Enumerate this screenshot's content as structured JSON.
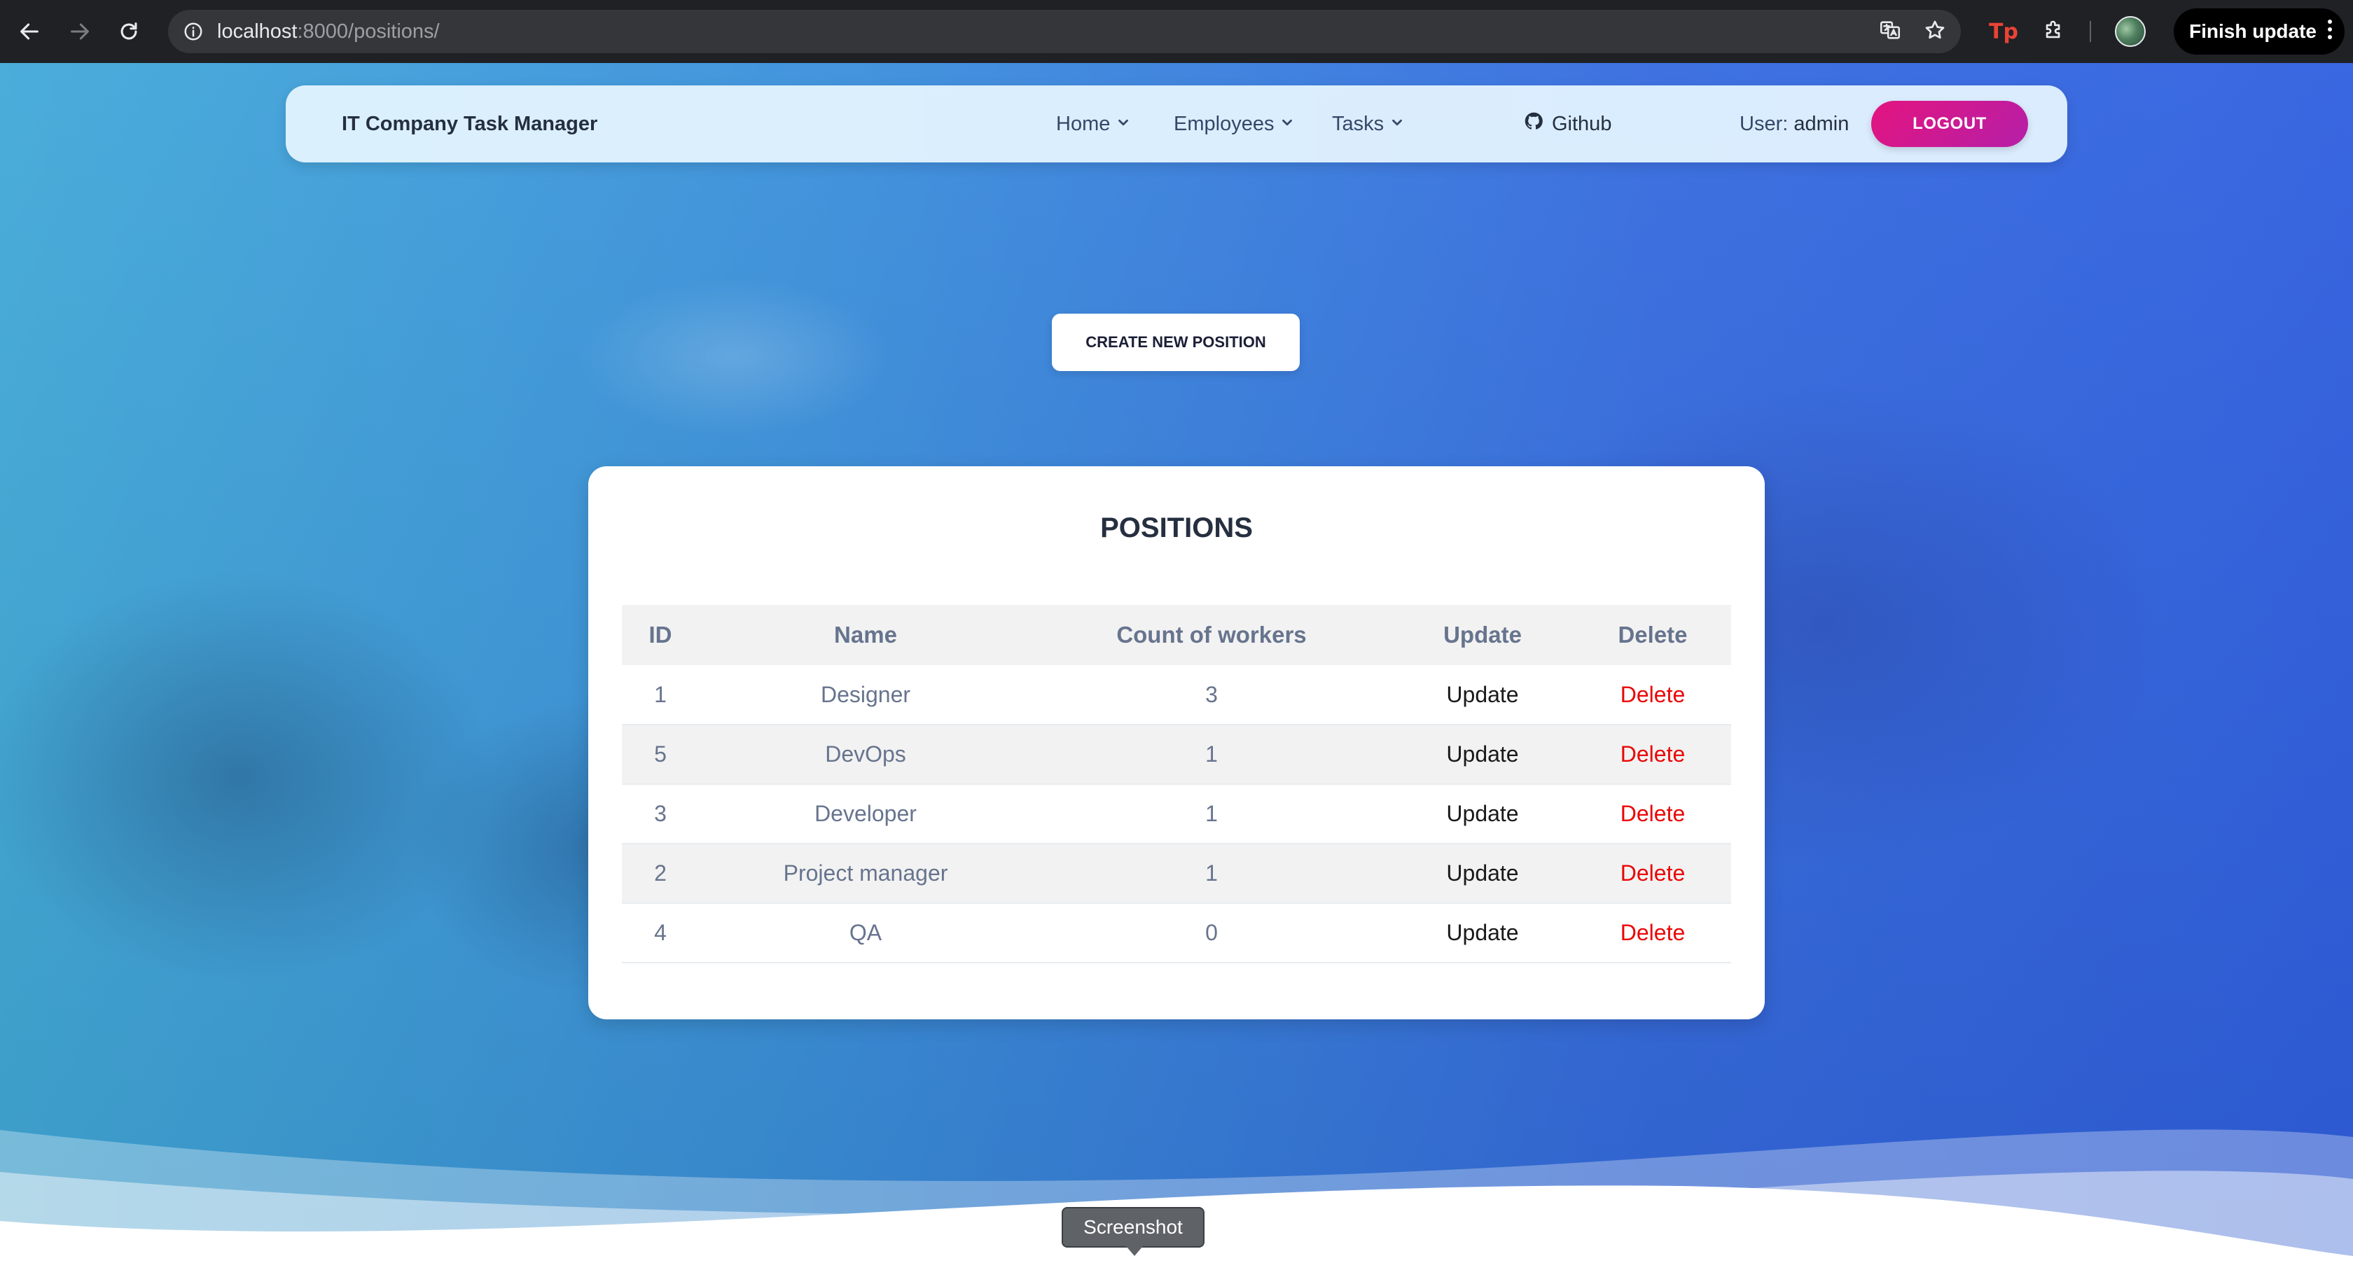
{
  "browser": {
    "url_host": "localhost",
    "url_path": ":8000/positions/",
    "finish_update_label": "Finish update",
    "icons": [
      "back-icon",
      "forward-icon",
      "reload-icon",
      "site-info-icon",
      "translate-icon",
      "bookmark-star-icon",
      "extension-tp-icon",
      "extensions-puzzle-icon",
      "profile-avatar",
      "more-vert-icon"
    ],
    "extension_tp_label": "Tp"
  },
  "navbar": {
    "brand": "IT Company Task Manager",
    "items": [
      {
        "label": "Home"
      },
      {
        "label": "Employees"
      },
      {
        "label": "Tasks"
      }
    ],
    "github_label": "Github",
    "user_prefix": "User:",
    "username": "admin",
    "logout_label": "LOGOUT",
    "logout_color_start": "#e3147f",
    "logout_color_end": "#b51fa8"
  },
  "create_button_label": "CREATE NEW POSITION",
  "positions_card": {
    "title": "POSITIONS",
    "columns": [
      "ID",
      "Name",
      "Count of workers",
      "Update",
      "Delete"
    ],
    "rows": [
      {
        "id": "1",
        "name": "Designer",
        "count": "3",
        "update": "Update",
        "delete": "Delete"
      },
      {
        "id": "5",
        "name": "DevOps",
        "count": "1",
        "update": "Update",
        "delete": "Delete"
      },
      {
        "id": "3",
        "name": "Developer",
        "count": "1",
        "update": "Update",
        "delete": "Delete"
      },
      {
        "id": "2",
        "name": "Project manager",
        "count": "1",
        "update": "Update",
        "delete": "Delete"
      },
      {
        "id": "4",
        "name": "QA",
        "count": "0",
        "update": "Update",
        "delete": "Delete"
      }
    ],
    "delete_color": "#ea0606"
  },
  "tooltip": "Screenshot"
}
